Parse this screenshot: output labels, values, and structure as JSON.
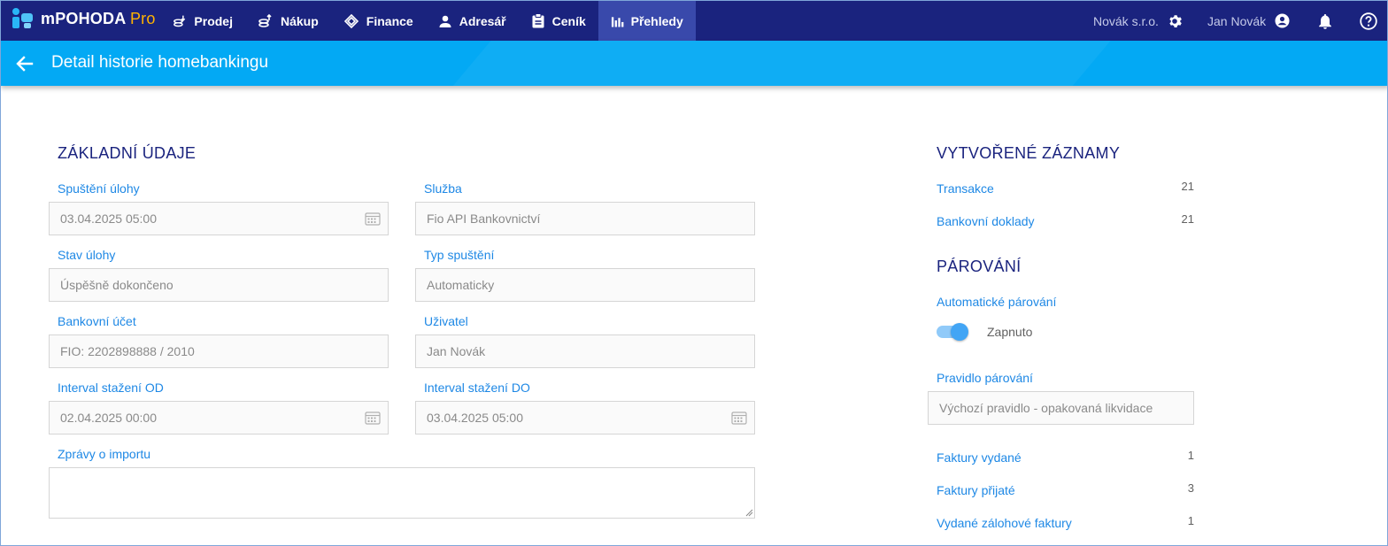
{
  "app": {
    "name": "mPOHODA",
    "edition": "Pro"
  },
  "nav": {
    "items": [
      {
        "label": "Prodej",
        "icon": "sales-icon"
      },
      {
        "label": "Nákup",
        "icon": "purchase-icon"
      },
      {
        "label": "Finance",
        "icon": "finance-icon"
      },
      {
        "label": "Adresář",
        "icon": "person-icon"
      },
      {
        "label": "Ceník",
        "icon": "clipboard-icon"
      },
      {
        "label": "Přehledy",
        "icon": "bar-chart-icon",
        "active": true
      }
    ],
    "company": "Novák s.r.o.",
    "user": "Jan Novák"
  },
  "page": {
    "title": "Detail historie homebankingu"
  },
  "basic": {
    "heading": "ZÁKLADNÍ ÚDAJE",
    "start_label": "Spuštění úlohy",
    "start_value": "03.04.2025 05:00",
    "service_label": "Služba",
    "service_value": "Fio API Bankovnictví",
    "state_label": "Stav úlohy",
    "state_value": "Úspěšně dokončeno",
    "run_type_label": "Typ spuštění",
    "run_type_value": "Automaticky",
    "account_label": "Bankovní účet",
    "account_value": "FIO: 2202898888 / 2010",
    "user_label": "Uživatel",
    "user_value": "Jan Novák",
    "from_label": "Interval stažení OD",
    "from_value": "02.04.2025 00:00",
    "to_label": "Interval stažení DO",
    "to_value": "03.04.2025 05:00",
    "messages_label": "Zprávy o importu",
    "messages_value": ""
  },
  "created": {
    "heading": "VYTVOŘENÉ ZÁZNAMY",
    "transactions_label": "Transakce",
    "transactions_count": "21",
    "bank_docs_label": "Bankovní doklady",
    "bank_docs_count": "21"
  },
  "matching": {
    "heading": "PÁROVÁNÍ",
    "auto_label": "Automatické párování",
    "auto_state": "Zapnuto",
    "auto_on": true,
    "rule_label": "Pravidlo párování",
    "rule_value": "Výchozí pravidlo - opakovaná likvidace",
    "issued_label": "Faktury vydané",
    "issued_count": "1",
    "received_label": "Faktury přijaté",
    "received_count": "3",
    "advance_label": "Vydané zálohové faktury",
    "advance_count": "1"
  },
  "colors": {
    "nav_bg": "#1a237e",
    "title_bg": "#03a9f4",
    "accent": "#1e88e5",
    "heading": "#1a237e"
  }
}
